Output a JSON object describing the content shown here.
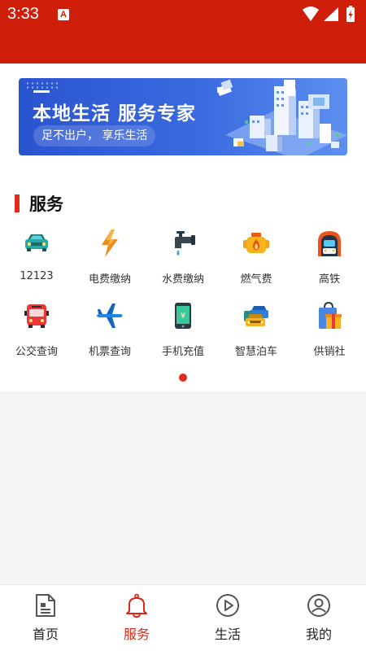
{
  "status_bar": {
    "time": "3:33",
    "notification_badge": "A",
    "icons": [
      "wifi-icon",
      "signal-icon",
      "battery-charging-icon"
    ]
  },
  "colors": {
    "brand_red": "#cf1f0b",
    "accent_red": "#e02c1c",
    "active_tab": "#d8281a",
    "banner_blue": "#3a6ae0"
  },
  "banner": {
    "title": "本地生活 服务专家",
    "subtitle": "足不出户， 享乐生活"
  },
  "services": {
    "heading": "服务",
    "items": [
      {
        "label": "12123",
        "icon": "car-icon"
      },
      {
        "label": "电费缴纳",
        "icon": "lightning-icon"
      },
      {
        "label": "水费缴纳",
        "icon": "water-tap-icon"
      },
      {
        "label": "燃气费",
        "icon": "gas-flame-icon"
      },
      {
        "label": "高铁",
        "icon": "high-speed-train-icon"
      },
      {
        "label": "公交查询",
        "icon": "bus-icon"
      },
      {
        "label": "机票查询",
        "icon": "airplane-icon"
      },
      {
        "label": "手机充值",
        "icon": "phone-recharge-icon"
      },
      {
        "label": "智慧泊车",
        "icon": "parking-cars-icon"
      },
      {
        "label": "供销社",
        "icon": "shopping-gift-icon"
      }
    ],
    "page_count": 1,
    "current_page": 1
  },
  "tabbar": {
    "active": "服务",
    "tabs": [
      {
        "label": "首页",
        "icon": "document-icon"
      },
      {
        "label": "服务",
        "icon": "bell-icon"
      },
      {
        "label": "生活",
        "icon": "play-circle-icon"
      },
      {
        "label": "我的",
        "icon": "user-circle-icon"
      }
    ]
  }
}
